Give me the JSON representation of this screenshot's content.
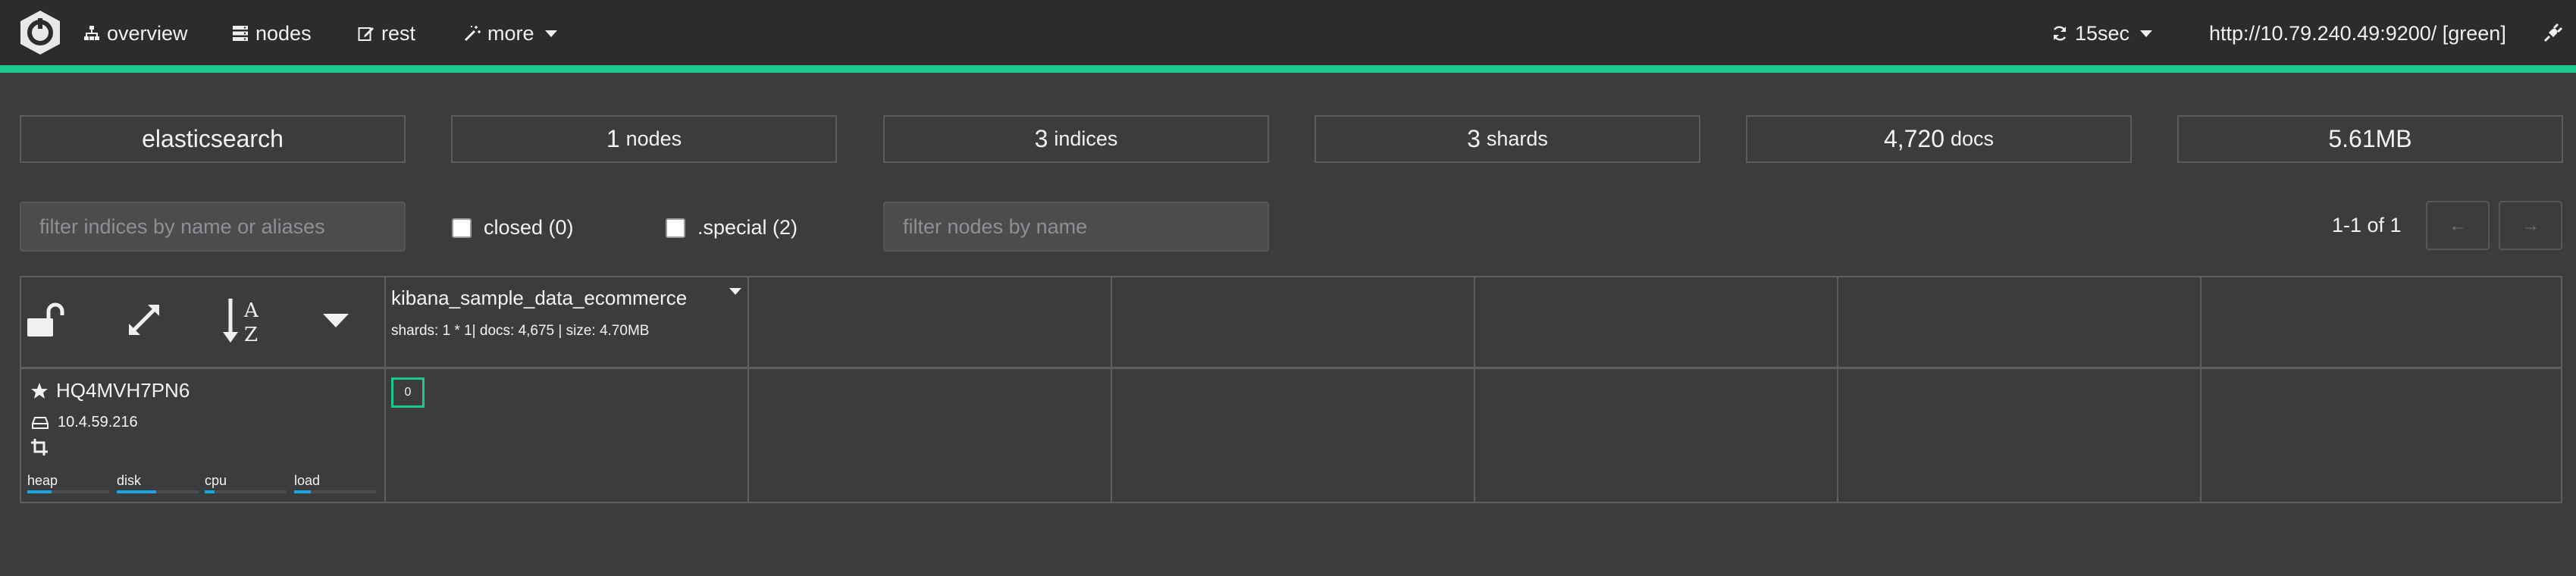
{
  "nav": {
    "overview": "overview",
    "nodes": "nodes",
    "rest": "rest",
    "more": "more",
    "refresh": "15sec",
    "cluster_url": "http://10.79.240.49:9200/ [green]"
  },
  "colors": {
    "accent": "#1bc98e",
    "bar_fill": "#1ea5e0",
    "topbar": "#2b2c2e",
    "background": "#3a3c3e"
  },
  "stats": {
    "cluster_name": "elasticsearch",
    "nodes_value": "1",
    "nodes_unit": "nodes",
    "indices_value": "3",
    "indices_unit": "indices",
    "shards_value": "3",
    "shards_unit": "shards",
    "docs_value": "4,720",
    "docs_unit": "docs",
    "size": "5.61MB"
  },
  "filters": {
    "indices_placeholder": "filter indices by name or aliases",
    "closed_label": "closed (0)",
    "special_label": ".special (2)",
    "nodes_placeholder": "filter nodes by name"
  },
  "pagination": {
    "text": "1-1 of 1",
    "prev": "←",
    "next": "→"
  },
  "index": {
    "name": "kibana_sample_data_ecommerce",
    "info": "shards: 1 * 1| docs: 4,675 | size: 4.70MB"
  },
  "node": {
    "name": "HQ4MVH7PN6",
    "ip": "10.4.59.216",
    "metrics": [
      {
        "label": "heap",
        "value": 0.3
      },
      {
        "label": "disk",
        "value": 0.48
      },
      {
        "label": "cpu",
        "value": 0.12
      },
      {
        "label": "load",
        "value": 0.2
      }
    ]
  },
  "shard": {
    "label": "0"
  },
  "icons": [
    "logo-icon",
    "sitemap-icon",
    "server-icon",
    "edit-icon",
    "magic-wand-icon",
    "refresh-icon",
    "plug-icon",
    "unlock-icon",
    "expand-icon",
    "sort-alpha-icon",
    "chevron-down-icon",
    "star-icon",
    "hdd-icon",
    "crop-icon"
  ]
}
